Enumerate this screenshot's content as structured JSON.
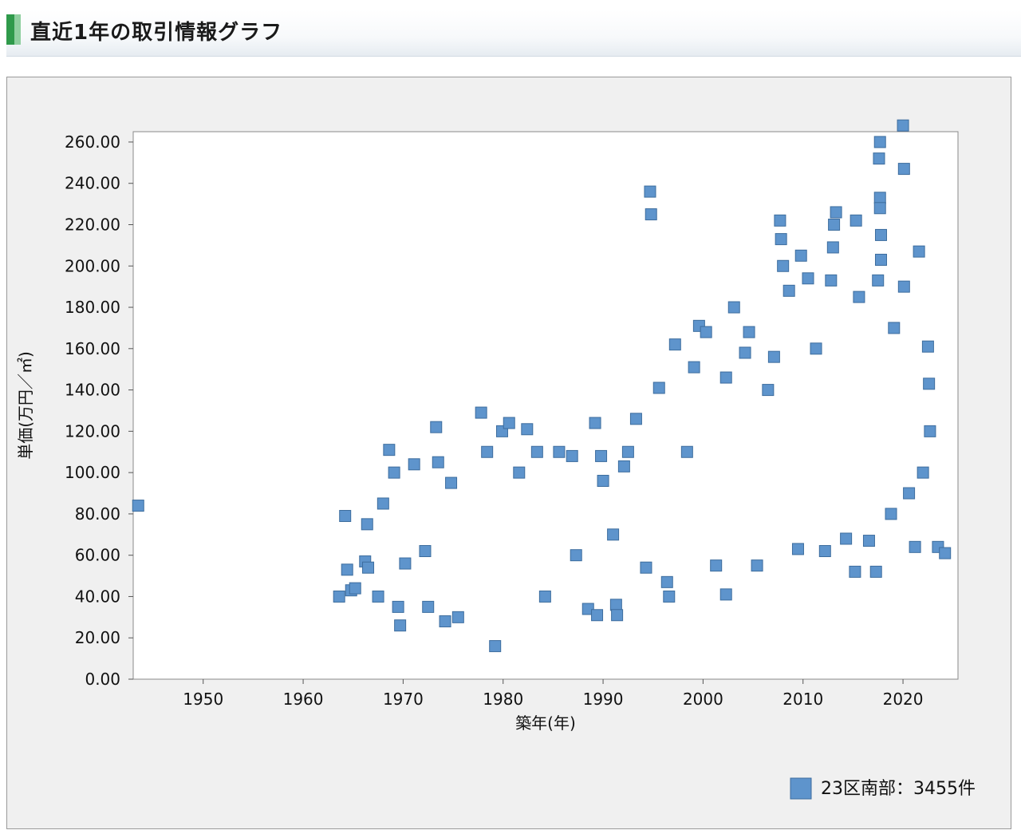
{
  "header": {
    "title": "直近1年の取引情報グラフ"
  },
  "colors": {
    "marker_fill": "#5e94cc",
    "marker_stroke": "#3d6d9e",
    "header_accent": "#2f9a4b"
  },
  "chart_data": {
    "type": "scatter",
    "title": "",
    "xlabel": "築年(年)",
    "ylabel": "単価(万円／㎡)",
    "xlim": [
      1943,
      2025.5
    ],
    "ylim": [
      0,
      265
    ],
    "x_ticks": [
      "1950",
      "1960",
      "1970",
      "1980",
      "1990",
      "2000",
      "2010",
      "2020"
    ],
    "y_ticks": [
      "0.00",
      "20.00",
      "40.00",
      "60.00",
      "80.00",
      "100.00",
      "120.00",
      "140.00",
      "160.00",
      "180.00",
      "200.00",
      "220.00",
      "240.00",
      "260.00"
    ],
    "grid": false,
    "legend_position": "bottom-right",
    "series": [
      {
        "name": "23区南部：3455件",
        "points": [
          [
            1943.5,
            84
          ],
          [
            1963.6,
            40
          ],
          [
            1964.2,
            79
          ],
          [
            1964.4,
            53
          ],
          [
            1964.8,
            43
          ],
          [
            1965.2,
            44
          ],
          [
            1966.2,
            57
          ],
          [
            1966.4,
            75
          ],
          [
            1966.5,
            54
          ],
          [
            1967.5,
            40
          ],
          [
            1968,
            85
          ],
          [
            1968.6,
            111
          ],
          [
            1969.1,
            100
          ],
          [
            1969.5,
            35
          ],
          [
            1969.7,
            26
          ],
          [
            1970.2,
            56
          ],
          [
            1971.1,
            104
          ],
          [
            1972.2,
            62
          ],
          [
            1972.5,
            35
          ],
          [
            1973.3,
            122
          ],
          [
            1973.5,
            105
          ],
          [
            1974.2,
            28
          ],
          [
            1974.8,
            95
          ],
          [
            1975.5,
            30
          ],
          [
            1977.8,
            129
          ],
          [
            1978.4,
            110
          ],
          [
            1979.2,
            16
          ],
          [
            1979.9,
            120
          ],
          [
            1980.6,
            124
          ],
          [
            1981.6,
            100
          ],
          [
            1982.4,
            121
          ],
          [
            1983.4,
            110
          ],
          [
            1984.2,
            40
          ],
          [
            1985.6,
            110
          ],
          [
            1986.9,
            108
          ],
          [
            1987.3,
            60
          ],
          [
            1988.5,
            34
          ],
          [
            1989.2,
            124
          ],
          [
            1989.4,
            31
          ],
          [
            1989.8,
            108
          ],
          [
            1990,
            96
          ],
          [
            1991,
            70
          ],
          [
            1991.3,
            36
          ],
          [
            1991.4,
            31
          ],
          [
            1992.1,
            103
          ],
          [
            1992.5,
            110
          ],
          [
            1993.3,
            126
          ],
          [
            1994.3,
            54
          ],
          [
            1994.7,
            236
          ],
          [
            1994.8,
            225
          ],
          [
            1995.6,
            141
          ],
          [
            1996.4,
            47
          ],
          [
            1996.6,
            40
          ],
          [
            1997.2,
            162
          ],
          [
            1998.4,
            110
          ],
          [
            1999.1,
            151
          ],
          [
            1999.6,
            171
          ],
          [
            2000.3,
            168
          ],
          [
            2001.3,
            55
          ],
          [
            2002.3,
            146
          ],
          [
            2002.3,
            41
          ],
          [
            2003.1,
            180
          ],
          [
            2004.2,
            158
          ],
          [
            2004.6,
            168
          ],
          [
            2005.4,
            55
          ],
          [
            2006.5,
            140
          ],
          [
            2007.1,
            156
          ],
          [
            2007.7,
            222
          ],
          [
            2007.8,
            213
          ],
          [
            2008,
            200
          ],
          [
            2008.6,
            188
          ],
          [
            2009.5,
            63
          ],
          [
            2009.8,
            205
          ],
          [
            2010.5,
            194
          ],
          [
            2011.3,
            160
          ],
          [
            2012.2,
            62
          ],
          [
            2012.8,
            193
          ],
          [
            2013,
            209
          ],
          [
            2013.1,
            220
          ],
          [
            2013.3,
            226
          ],
          [
            2014.3,
            68
          ],
          [
            2015.2,
            52
          ],
          [
            2015.3,
            222
          ],
          [
            2015.6,
            185
          ],
          [
            2016.6,
            67
          ],
          [
            2017.3,
            52
          ],
          [
            2017.5,
            193
          ],
          [
            2017.6,
            252
          ],
          [
            2017.7,
            260
          ],
          [
            2017.7,
            233
          ],
          [
            2017.7,
            228
          ],
          [
            2017.8,
            215
          ],
          [
            2017.8,
            203
          ],
          [
            2018.8,
            80
          ],
          [
            2019.1,
            170
          ],
          [
            2020,
            268
          ],
          [
            2020.1,
            247
          ],
          [
            2020.1,
            190
          ],
          [
            2020.6,
            90
          ],
          [
            2021.2,
            64
          ],
          [
            2021.6,
            207
          ],
          [
            2022,
            100
          ],
          [
            2022.5,
            161
          ],
          [
            2022.6,
            143
          ],
          [
            2022.7,
            120
          ],
          [
            2023.5,
            64
          ],
          [
            2024.2,
            61
          ]
        ]
      }
    ]
  }
}
